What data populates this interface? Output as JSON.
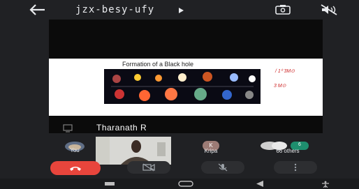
{
  "header": {
    "meeting_code": "jzx-besy-ufy"
  },
  "slide": {
    "title": "Formation of a Black hole",
    "note1": "/ 1⁰ 3M⊙",
    "note2": "3 M⊙"
  },
  "presenter": {
    "name": "Tharanath R"
  },
  "participants": {
    "you_label": "You",
    "kripa_initial": "K",
    "kripa_label": "Kripa",
    "others_count": "6",
    "others_label": "66 others"
  },
  "colors": {
    "end_call": "#e8453c",
    "others_badge": "#1e8e6e",
    "background": "#202124"
  }
}
